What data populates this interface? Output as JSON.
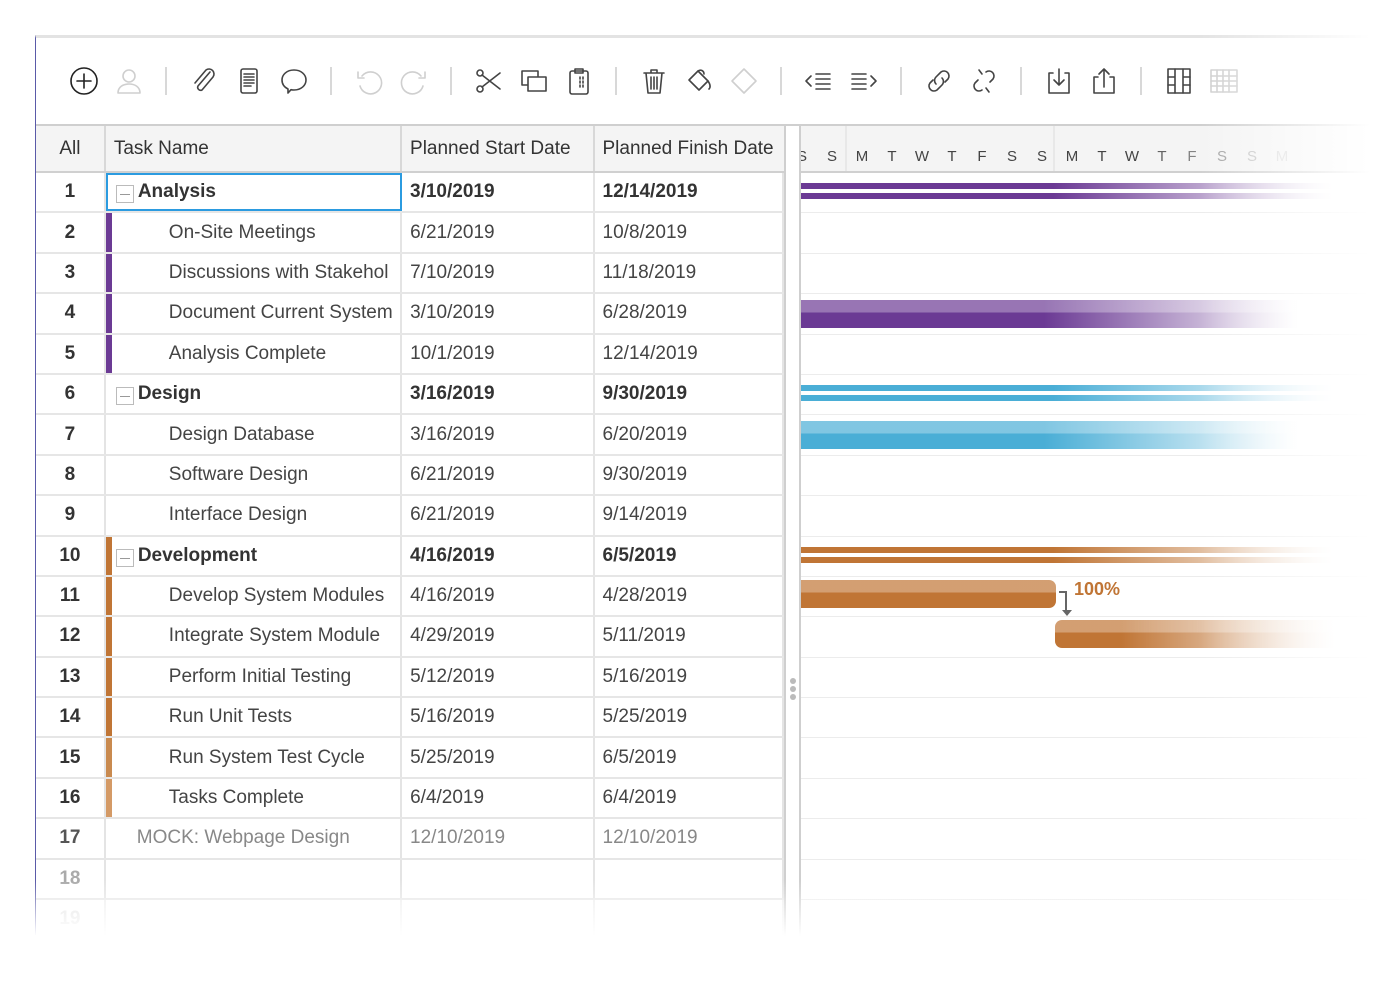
{
  "toolbar": {
    "groups": [
      [
        {
          "icon": "add-icon",
          "label": "Add Task",
          "enabled": true
        },
        {
          "icon": "assign-user-icon",
          "label": "Assign User",
          "enabled": false
        }
      ],
      [
        {
          "icon": "attachment-icon",
          "label": "Attachment",
          "enabled": true
        },
        {
          "icon": "notes-icon",
          "label": "Notes",
          "enabled": true
        },
        {
          "icon": "comment-icon",
          "label": "Comment",
          "enabled": true
        }
      ],
      [
        {
          "icon": "undo-icon",
          "label": "Undo",
          "enabled": false
        },
        {
          "icon": "redo-icon",
          "label": "Redo",
          "enabled": false
        }
      ],
      [
        {
          "icon": "cut-icon",
          "label": "Cut",
          "enabled": true
        },
        {
          "icon": "copy-icon",
          "label": "Copy",
          "enabled": true
        },
        {
          "icon": "paste-icon",
          "label": "Paste",
          "enabled": true
        }
      ],
      [
        {
          "icon": "delete-icon",
          "label": "Delete",
          "enabled": true
        },
        {
          "icon": "paint-bucket-icon",
          "label": "Color",
          "enabled": true
        },
        {
          "icon": "milestone-icon",
          "label": "Milestone",
          "enabled": false
        }
      ],
      [
        {
          "icon": "outdent-icon",
          "label": "Outdent",
          "enabled": true
        },
        {
          "icon": "indent-icon",
          "label": "Indent",
          "enabled": true
        }
      ],
      [
        {
          "icon": "link-icon",
          "label": "Link",
          "enabled": true
        },
        {
          "icon": "unlink-icon",
          "label": "Unlink",
          "enabled": true
        }
      ],
      [
        {
          "icon": "import-icon",
          "label": "Import",
          "enabled": true
        },
        {
          "icon": "export-icon",
          "label": "Export",
          "enabled": true
        }
      ],
      [
        {
          "icon": "columns-icon",
          "label": "Columns",
          "enabled": true
        },
        {
          "icon": "table-icon",
          "label": "Table",
          "enabled": false
        }
      ]
    ]
  },
  "grid": {
    "headers": {
      "num": "All",
      "name": "Task Name",
      "start": "Planned Start Date",
      "finish": "Planned Finish Date"
    },
    "rows": [
      {
        "num": "1",
        "name": "Analysis",
        "start": "3/10/2019",
        "finish": "12/14/2019",
        "type": "summary",
        "color": "",
        "selected": true
      },
      {
        "num": "2",
        "name": "On-Site Meetings",
        "start": "6/21/2019",
        "finish": "10/8/2019",
        "type": "child",
        "color": "#6b3a94"
      },
      {
        "num": "3",
        "name": "Discussions with Stakehol",
        "start": "7/10/2019",
        "finish": "11/18/2019",
        "type": "child",
        "color": "#6b3a94"
      },
      {
        "num": "4",
        "name": "Document Current System",
        "start": "3/10/2019",
        "finish": "6/28/2019",
        "type": "child",
        "color": "#6b3a94"
      },
      {
        "num": "5",
        "name": "Analysis Complete",
        "start": "10/1/2019",
        "finish": "12/14/2019",
        "type": "child",
        "color": "#6b3a94"
      },
      {
        "num": "6",
        "name": "Design",
        "start": "3/16/2019",
        "finish": "9/30/2019",
        "type": "summary",
        "color": ""
      },
      {
        "num": "7",
        "name": "Design Database",
        "start": "3/16/2019",
        "finish": "6/20/2019",
        "type": "child",
        "color": ""
      },
      {
        "num": "8",
        "name": "Software Design",
        "start": "6/21/2019",
        "finish": "9/30/2019",
        "type": "child",
        "color": ""
      },
      {
        "num": "9",
        "name": "Interface Design",
        "start": "6/21/2019",
        "finish": "9/14/2019",
        "type": "child",
        "color": ""
      },
      {
        "num": "10",
        "name": "Development",
        "start": "4/16/2019",
        "finish": "6/5/2019",
        "type": "summary",
        "color": "#c07535"
      },
      {
        "num": "11",
        "name": "Develop System Modules",
        "start": "4/16/2019",
        "finish": "4/28/2019",
        "type": "child",
        "color": "#c07535"
      },
      {
        "num": "12",
        "name": "Integrate System Module",
        "start": "4/29/2019",
        "finish": "5/11/2019",
        "type": "child",
        "color": "#c07535"
      },
      {
        "num": "13",
        "name": "Perform Initial Testing",
        "start": "5/12/2019",
        "finish": "5/16/2019",
        "type": "child",
        "color": "#c07535"
      },
      {
        "num": "14",
        "name": "Run Unit Tests",
        "start": "5/16/2019",
        "finish": "5/25/2019",
        "type": "child",
        "color": "#c07535"
      },
      {
        "num": "15",
        "name": "Run System Test Cycle",
        "start": "5/25/2019",
        "finish": "6/5/2019",
        "type": "child",
        "color": "#c98a4f"
      },
      {
        "num": "16",
        "name": "Tasks Complete",
        "start": "6/4/2019",
        "finish": "6/4/2019",
        "type": "child",
        "color": "#d49a66"
      },
      {
        "num": "17",
        "name": "MOCK: Webpage Design",
        "start": "12/10/2019",
        "finish": "12/10/2019",
        "type": "mock",
        "color": ""
      },
      {
        "num": "18",
        "name": "",
        "start": "",
        "finish": "",
        "type": "empty",
        "color": ""
      },
      {
        "num": "19",
        "name": "",
        "start": "",
        "finish": "",
        "type": "faded",
        "color": ""
      }
    ]
  },
  "gantt": {
    "days": [
      "S",
      "S",
      "M",
      "T",
      "W",
      "T",
      "F",
      "S",
      "S",
      "M",
      "T",
      "W",
      "T",
      "F",
      "S",
      "S",
      "M"
    ],
    "colors": {
      "analysis": "#6b3a94",
      "design": "#4aaed6",
      "development": "#c07535"
    },
    "bars": [
      {
        "row": 0,
        "kind": "summary",
        "group": "analysis"
      },
      {
        "row": 3,
        "kind": "task",
        "group": "analysis"
      },
      {
        "row": 5,
        "kind": "summary",
        "group": "design"
      },
      {
        "row": 6,
        "kind": "task",
        "group": "design"
      },
      {
        "row": 9,
        "kind": "summary",
        "group": "development"
      },
      {
        "row": 10,
        "kind": "task-rounded",
        "group": "development",
        "progress_label": "100%"
      },
      {
        "row": 11,
        "kind": "task-rounded",
        "group": "development"
      }
    ]
  }
}
